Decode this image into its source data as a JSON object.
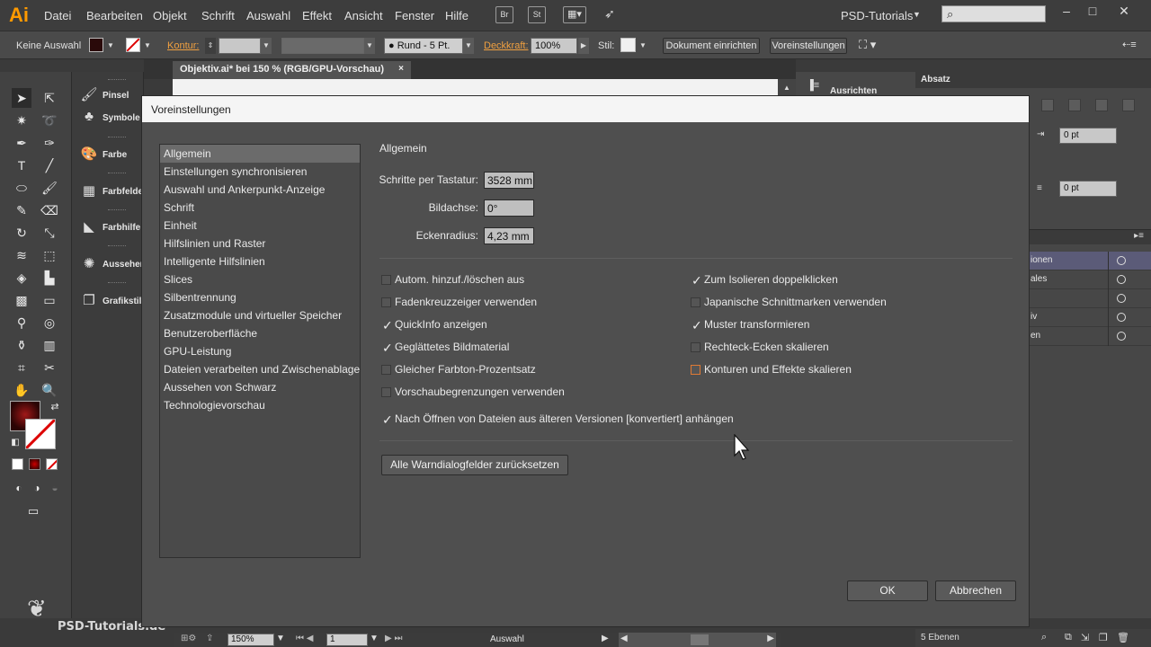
{
  "app": {
    "logo": "Ai",
    "workspace": "PSD-Tutorials"
  },
  "menu": [
    "Datei",
    "Bearbeiten",
    "Objekt",
    "Schrift",
    "Auswahl",
    "Effekt",
    "Ansicht",
    "Fenster",
    "Hilfe"
  ],
  "menubar_buttons": [
    "Br",
    "St"
  ],
  "window_controls": [
    "–",
    "□",
    "✕"
  ],
  "control_bar": {
    "selection": "Keine Auswahl",
    "kontur_label": "Kontur:",
    "brush": "Rund - 5 Pt.",
    "deckkraft_label": "Deckkraft:",
    "deckkraft_value": "100%",
    "stil_label": "Stil:",
    "btn_document_setup": "Dokument einrichten",
    "btn_preferences": "Voreinstellungen"
  },
  "document": {
    "tab_title": "Objektiv.ai* bei 150 % (RGB/GPU-Vorschau)",
    "close": "×"
  },
  "dock": [
    "Pinsel",
    "Symbole",
    "Farbe",
    "Farbfelder",
    "Farbhilfe",
    "Aussehen",
    "Grafikstile"
  ],
  "right_panels": {
    "ausrichten": "Ausrichten",
    "absatz": "Absatz",
    "indent_value": "0 pt",
    "space_value": "0 pt",
    "layers": [
      "ionen",
      "ales",
      "",
      "iv",
      "en"
    ],
    "layer_count": "5 Ebenen"
  },
  "status_bar": {
    "zoom": "150%",
    "page": "1",
    "tool": "Auswahl"
  },
  "watermark": "PSD-Tutorials.de",
  "dialog": {
    "title": "Voreinstellungen",
    "categories": [
      "Allgemein",
      "Einstellungen synchronisieren",
      "Auswahl und Ankerpunkt-Anzeige",
      "Schrift",
      "Einheit",
      "Hilfslinien und Raster",
      "Intelligente Hilfslinien",
      "Slices",
      "Silbentrennung",
      "Zusatzmodule und virtueller Speicher",
      "Benutzeroberfläche",
      "GPU-Leistung",
      "Dateien verarbeiten und Zwischenablage",
      "Aussehen von Schwarz",
      "Technologievorschau"
    ],
    "selected_category": "Allgemein",
    "section_heading": "Allgemein",
    "fields": [
      {
        "label": "Schritte per Tastatur:",
        "value": "3528 mm"
      },
      {
        "label": "Bildachse:",
        "value": "0°"
      },
      {
        "label": "Eckenradius:",
        "value": "4,23 mm"
      }
    ],
    "options_left": [
      {
        "label": "Autom. hinzuf./löschen aus",
        "checked": false
      },
      {
        "label": "Fadenkreuzzeiger verwenden",
        "checked": false
      },
      {
        "label": "QuickInfo anzeigen",
        "checked": true
      },
      {
        "label": "Geglättetes Bildmaterial",
        "checked": true
      },
      {
        "label": "Gleicher Farbton-Prozentsatz",
        "checked": false
      },
      {
        "label": "Vorschaubegrenzungen verwenden",
        "checked": false
      }
    ],
    "options_right": [
      {
        "label": "Zum Isolieren doppelklicken",
        "checked": true
      },
      {
        "label": "Japanische Schnittmarken verwenden",
        "checked": false
      },
      {
        "label": "Muster transformieren",
        "checked": true
      },
      {
        "label": "Rechteck-Ecken skalieren",
        "checked": false
      },
      {
        "label": "Konturen und Effekte skalieren",
        "checked": false
      }
    ],
    "option_full": {
      "label": "Nach Öffnen von Dateien aus älteren Versionen [konvertiert] anhängen",
      "checked": true
    },
    "reset_button": "Alle Warndialogfelder zurücksetzen",
    "ok_button": "OK",
    "cancel_button": "Abbrechen"
  }
}
